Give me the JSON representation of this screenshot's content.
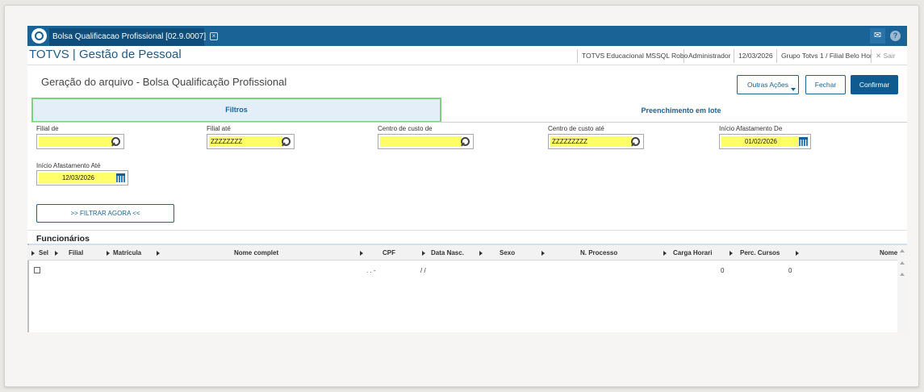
{
  "titlebar": {
    "tab_label": "Bolsa Qualificacao Profissional [02.9.0007]",
    "tab_close": "×"
  },
  "header": {
    "brand": "TOTVS | Gestão de Pessoal",
    "status": [
      "TOTVS Educacional MSSQL Robo",
      "Administrador",
      "12/03/2026",
      "Grupo Totvs 1 / Filial Belo Hor"
    ],
    "sair_icon": "✕",
    "sair_label": "Sair"
  },
  "page": {
    "title": "Geração do arquivo - Bolsa Qualificação Profissional"
  },
  "actions": {
    "outras": "Outras Ações",
    "fechar": "Fechar",
    "confirmar": "Confirmar"
  },
  "tabs": {
    "filtros": "Filtros",
    "lote": "Preenchimento em lote"
  },
  "fields": {
    "filial_de": {
      "label": "Filial de",
      "value": ""
    },
    "filial_ate": {
      "label": "Filial até",
      "value": "ZZZZZZZZ"
    },
    "cc_de": {
      "label": "Centro de custo de",
      "value": ""
    },
    "cc_ate": {
      "label": "Centro de custo até",
      "value": "ZZZZZZZZZ"
    },
    "afast_de": {
      "label": "Início Afastamento De",
      "value": "01/02/2026"
    },
    "afast_ate": {
      "label": "Início Afastamento Até",
      "value": "12/03/2026"
    }
  },
  "filter_button": ">> FILTRAR AGORA <<",
  "grid": {
    "title": "Funcionários",
    "headers": {
      "sel": "Sel",
      "filial": "Filial",
      "matricula": "Matrícula",
      "nome": "Nome complet",
      "cpf": "CPF",
      "data_nasc": "Data Nasc.",
      "sexo": "Sexo",
      "n_processo": "N. Processo",
      "carga": "Carga Horari",
      "perc": "Perc. Cursos",
      "nome2": "Nome"
    },
    "row": {
      "cpf": ". . -",
      "data": "/ /",
      "carga": "0",
      "perc": "0"
    }
  },
  "colors": {
    "titlebar": "#1a6397",
    "accent": "#1a6397",
    "highlight": "#ffff6a",
    "active_tab_border": "#7cd37a"
  },
  "icons": [
    "logo-icon",
    "mail-icon",
    "help-icon",
    "search-icon",
    "calendar-icon",
    "checkbox-icon"
  ]
}
